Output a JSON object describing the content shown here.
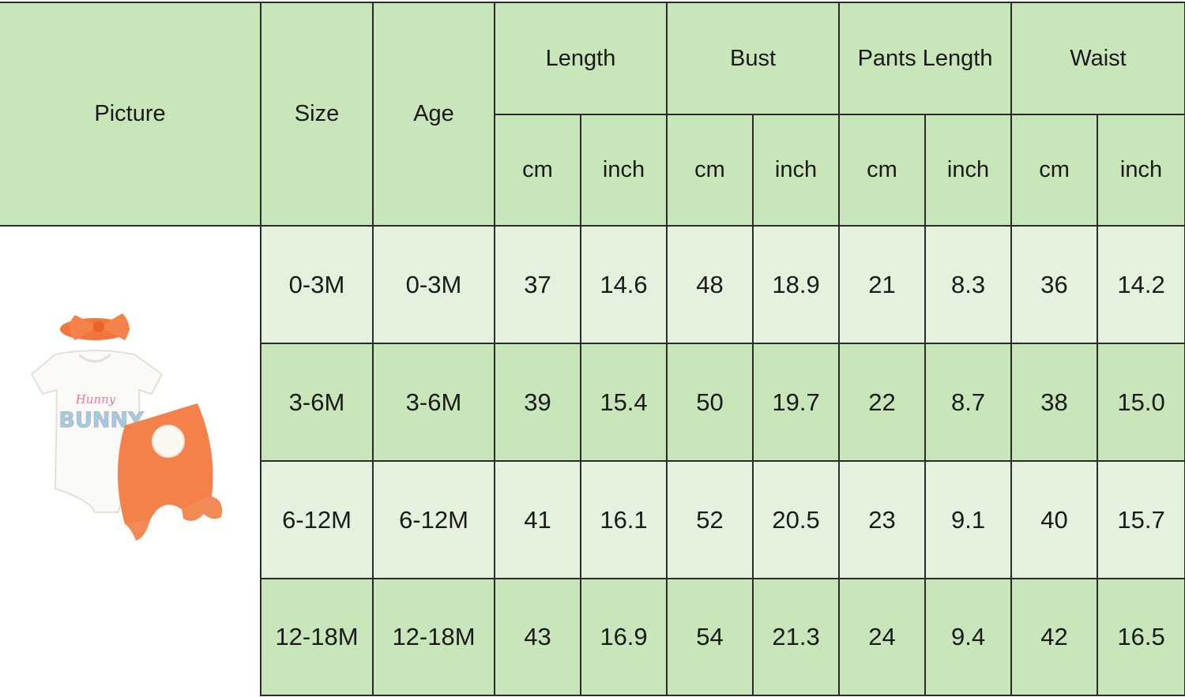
{
  "header": {
    "picture": "Picture",
    "size": "Size",
    "age": "Age",
    "length": "Length",
    "bust": "Bust",
    "pants_length": "Pants Length",
    "waist": "Waist"
  },
  "units": [
    "cm",
    "inch",
    "cm",
    "inch",
    "cm",
    "inch",
    "cm",
    "inch"
  ],
  "rows": [
    {
      "size": "0-3M",
      "age": "0-3M",
      "values": [
        "37",
        "14.6",
        "48",
        "18.9",
        "21",
        "8.3",
        "36",
        "14.2"
      ]
    },
    {
      "size": "3-6M",
      "age": "3-6M",
      "values": [
        "39",
        "15.4",
        "50",
        "19.7",
        "22",
        "8.7",
        "38",
        "15.0"
      ]
    },
    {
      "size": "6-12M",
      "age": "6-12M",
      "values": [
        "41",
        "16.1",
        "52",
        "20.5",
        "23",
        "9.1",
        "40",
        "15.7"
      ]
    },
    {
      "size": "12-18M",
      "age": "12-18M",
      "values": [
        "43",
        "16.9",
        "54",
        "21.3",
        "24",
        "9.4",
        "42",
        "16.5"
      ]
    }
  ],
  "product_image": {
    "onesie_script_text": "Hunny",
    "onesie_patch_text": "BUNNY"
  },
  "colors": {
    "header_green": "#c8e6b9",
    "light_green": "#e4f2dd",
    "orange": "#f0763c"
  }
}
